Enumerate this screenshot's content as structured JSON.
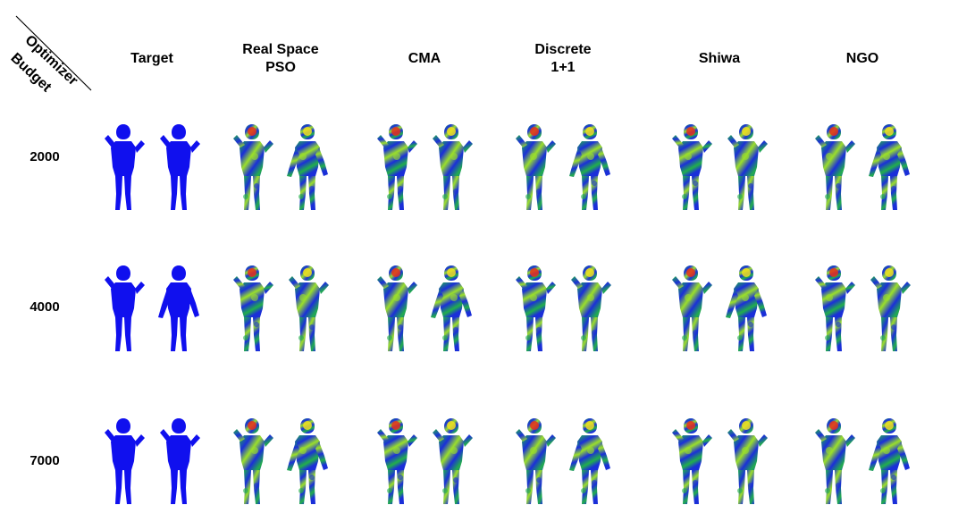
{
  "header": {
    "corner_top_label": "Optimizer",
    "corner_bottom_label": "Budget",
    "columns": [
      {
        "lines": [
          "Target"
        ],
        "palette": "target"
      },
      {
        "lines": [
          "Real Space",
          "PSO"
        ],
        "palette": "heat"
      },
      {
        "lines": [
          "CMA"
        ],
        "palette": "heat"
      },
      {
        "lines": [
          "Discrete",
          "1+1"
        ],
        "palette": "heat"
      },
      {
        "lines": [
          "Shiwa"
        ],
        "palette": "heat"
      },
      {
        "lines": [
          "NGO"
        ],
        "palette": "heat"
      }
    ]
  },
  "rows": [
    {
      "label": "2000"
    },
    {
      "label": "4000"
    },
    {
      "label": "7000"
    }
  ],
  "colors": {
    "target_blue": "#1010ee",
    "heat_low": "#1a2fd8",
    "heat_mid": "#22b04a",
    "heat_high_green": "#9be02a",
    "heat_warm": "#f0e020",
    "heat_hot": "#e8301a"
  }
}
